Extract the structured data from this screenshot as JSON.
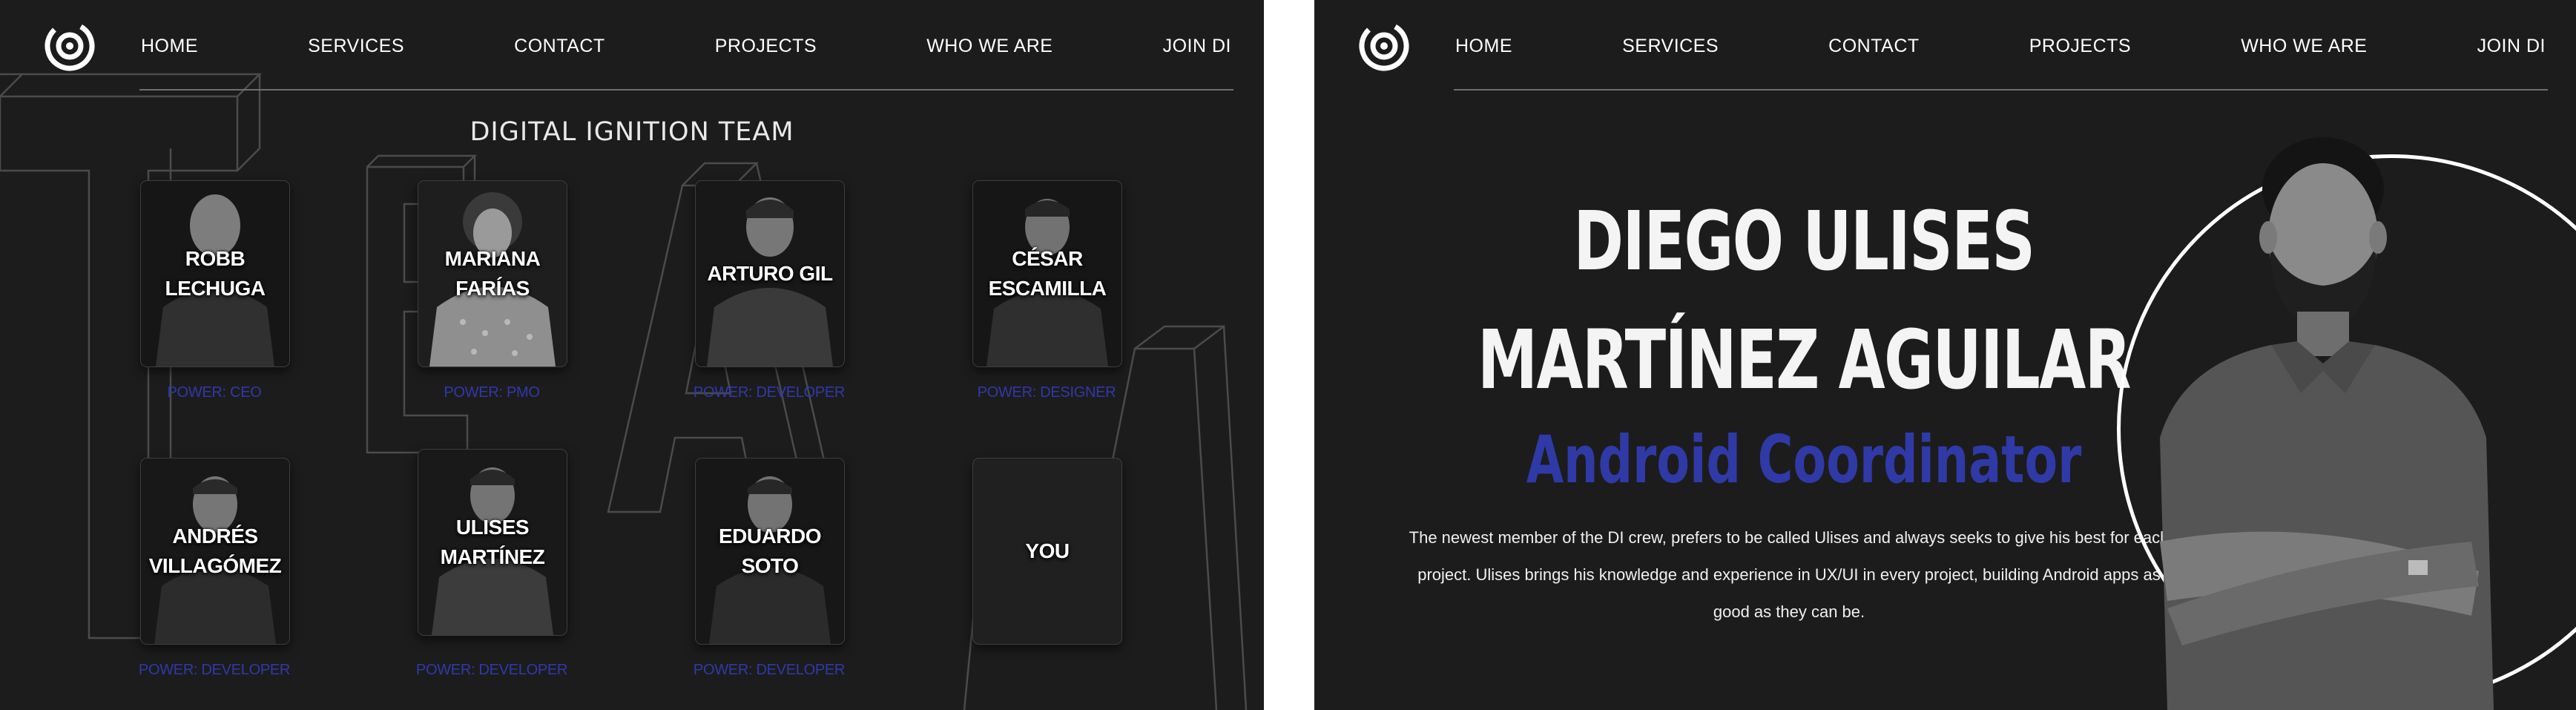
{
  "nav": {
    "items": [
      "HOME",
      "SERVICES",
      "CONTACT",
      "PROJECTS",
      "WHO WE ARE",
      "JOIN DI"
    ]
  },
  "logo": {
    "icon": "digital-ignition-logo-icon"
  },
  "team_page": {
    "title": "DIGITAL IGNITION TEAM",
    "background_word": "TEAM",
    "members": [
      {
        "name": "ROBB LECHUGA",
        "power": "POWER: CEO"
      },
      {
        "name": "MARIANA FARÍAS",
        "power": "POWER: PMO"
      },
      {
        "name": "ARTURO GIL",
        "power": "POWER: DEVELOPER"
      },
      {
        "name": "CÉSAR ESCAMILLA",
        "power": "POWER: DESIGNER"
      },
      {
        "name": "ANDRÉS VILLAGÓMEZ",
        "power": "POWER: DEVELOPER"
      },
      {
        "name": "ULISES MARTÍNEZ",
        "power": "POWER: DEVELOPER"
      },
      {
        "name": "EDUARDO SOTO",
        "power": "POWER: DEVELOPER"
      },
      {
        "name": "YOU",
        "power": ""
      }
    ]
  },
  "member_page": {
    "full_name": "DIEGO ULISES MARTÍNEZ AGUILAR",
    "role": "Android Coordinator",
    "description": "The newest member of the DI crew, prefers to be called Ulises and always seeks to give his best for each project. Ulises brings his knowledge and experience in UX/UI in every project, building Android apps as good as they can be."
  },
  "colors": {
    "background": "#1c1c1d",
    "accent": "#2f3aa6",
    "text": "#ffffff"
  }
}
